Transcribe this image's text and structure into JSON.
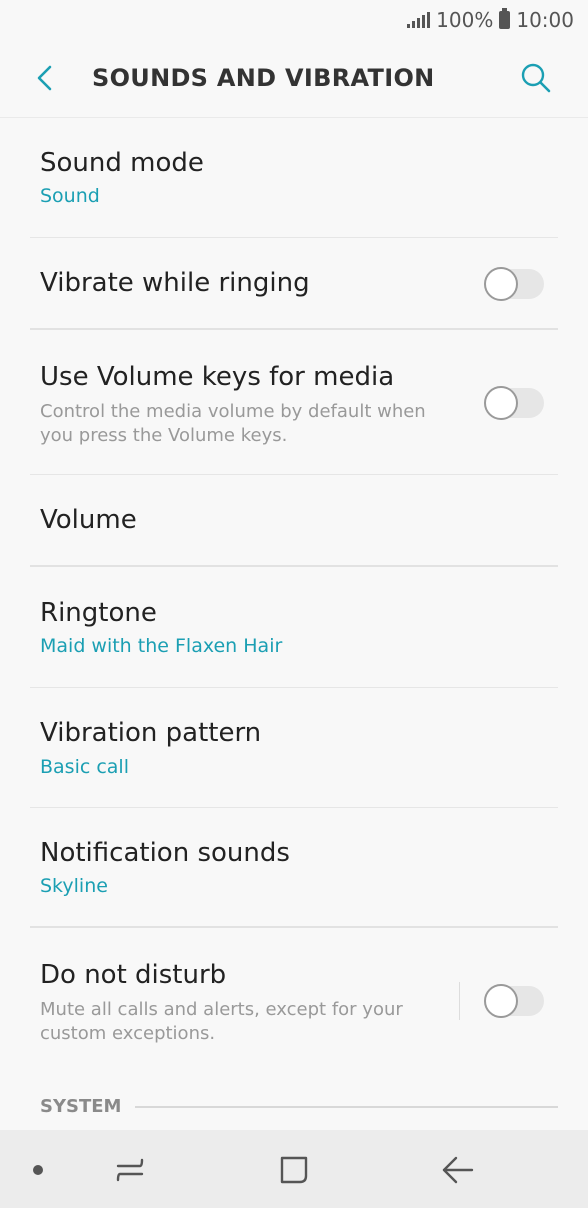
{
  "status_bar": {
    "battery_text": "100%",
    "time": "10:00",
    "icons": [
      "signal-icon",
      "battery-icon"
    ]
  },
  "header": {
    "title": "SOUNDS AND VIBRATION",
    "back_icon": "back-arrow-icon",
    "search_icon": "search-icon"
  },
  "settings": [
    {
      "id": "sound-mode",
      "title": "Sound mode",
      "value": "Sound"
    },
    {
      "id": "vibrate-while-ringing",
      "title": "Vibrate while ringing",
      "toggle": false
    },
    {
      "id": "volume-keys-media",
      "title": "Use Volume keys for media",
      "description": "Control the media volume by default when you press the Volume keys.",
      "toggle": false
    },
    {
      "id": "volume",
      "title": "Volume"
    },
    {
      "id": "ringtone",
      "title": "Ringtone",
      "value": "Maid with the Flaxen Hair"
    },
    {
      "id": "vibration-pattern",
      "title": "Vibration pattern",
      "value": "Basic call"
    },
    {
      "id": "notification-sounds",
      "title": "Notification sounds",
      "value": "Skyline"
    },
    {
      "id": "do-not-disturb",
      "title": "Do not disturb",
      "description": "Mute all calls and alerts, except for your custom exceptions.",
      "toggle": false
    }
  ],
  "section": {
    "label": "SYSTEM"
  },
  "nav_bar": {
    "icons": [
      "dot-icon",
      "recents-icon",
      "home-icon",
      "back-icon"
    ]
  },
  "colors": {
    "accent": "#1b9fb3",
    "background": "#f8f8f8",
    "nav_background": "#ececec"
  }
}
